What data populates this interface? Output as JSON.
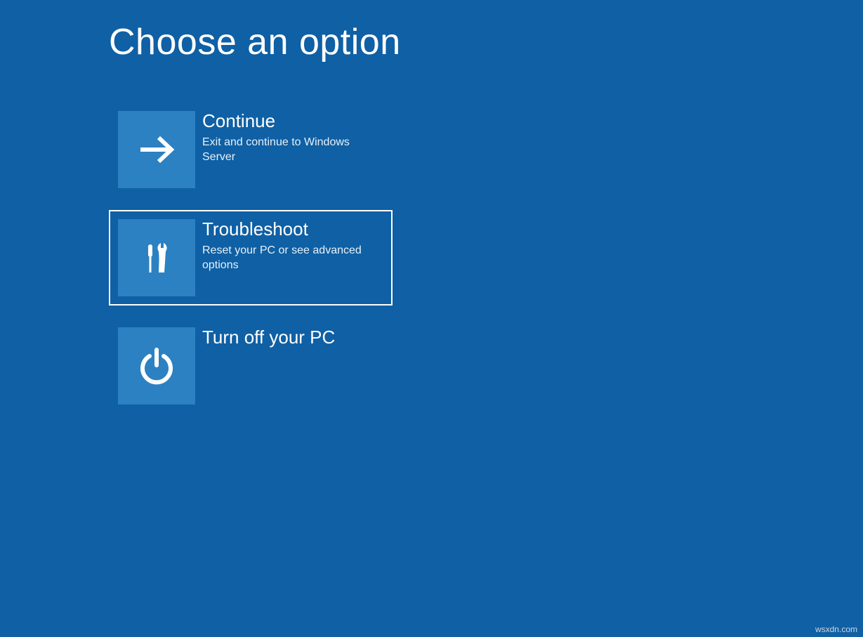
{
  "title": "Choose an option",
  "options": [
    {
      "title": "Continue",
      "desc": "Exit and continue to Windows Server"
    },
    {
      "title": "Troubleshoot",
      "desc": "Reset your PC or see advanced options"
    },
    {
      "title": "Turn off your PC",
      "desc": ""
    }
  ],
  "watermark": "wsxdn.com"
}
